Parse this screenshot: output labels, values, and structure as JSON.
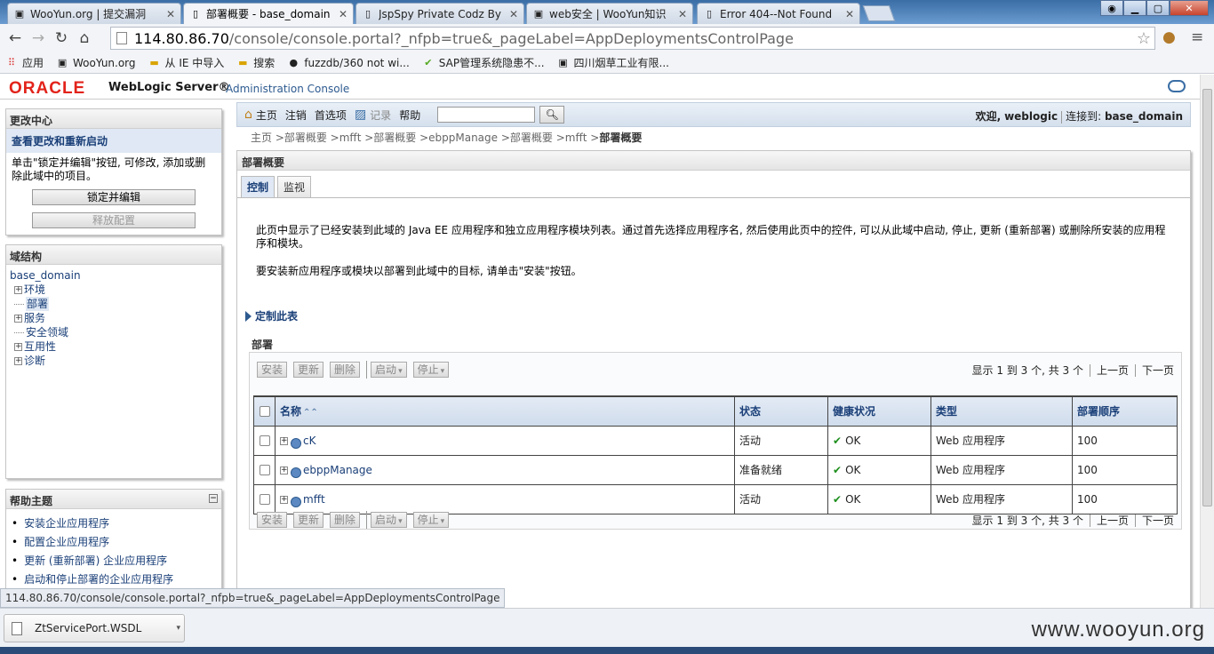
{
  "browser": {
    "tabs": [
      {
        "title": "WooYun.org | 提交漏洞",
        "active": false
      },
      {
        "title": "部署概要 - base_domain",
        "active": true
      },
      {
        "title": "JspSpy Private Codz By",
        "active": false
      },
      {
        "title": "web安全 | WooYun知识",
        "active": false
      },
      {
        "title": "Error 404--Not Found",
        "active": false
      }
    ],
    "url_host": "114.80.86.70",
    "url_path": "/console/console.portal?_nfpb=true&_pageLabel=AppDeploymentsControlPage",
    "bookmarks": [
      "应用",
      "WooYun.org",
      "从 IE 中导入",
      "搜索",
      "fuzzdb/360 not wi...",
      "SAP管理系统隐患不...",
      "四川烟草工业有限..."
    ],
    "status_url": "114.80.86.70/console/console.portal?_nfpb=true&_pageLabel=AppDeploymentsControlPage",
    "download_file": "ZtServicePort.WSDL",
    "watermark": "www.wooyun.org"
  },
  "header": {
    "oracle": "ORACLE",
    "product": "WebLogic Server®",
    "subtitle": "Administration Console"
  },
  "change_center": {
    "title": "更改中心",
    "subtitle": "查看更改和重新启动",
    "text": "单击\"锁定并编辑\"按钮, 可修改, 添加或删除此域中的项目。",
    "lock_btn": "锁定并编辑",
    "release_btn": "释放配置"
  },
  "domain_structure": {
    "title": "域结构",
    "root": "base_domain",
    "nodes": [
      {
        "label": "环境",
        "expandable": true
      },
      {
        "label": "部署",
        "expandable": false,
        "selected": true
      },
      {
        "label": "服务",
        "expandable": true
      },
      {
        "label": "安全领域",
        "expandable": false
      },
      {
        "label": "互用性",
        "expandable": true
      },
      {
        "label": "诊断",
        "expandable": true
      }
    ]
  },
  "help_topics": {
    "title": "帮助主题",
    "items": [
      "安装企业应用程序",
      "配置企业应用程序",
      "更新 (重新部署) 企业应用程序",
      "启动和停止部署的企业应用程序"
    ]
  },
  "menubar": {
    "home": "主页",
    "logout": "注销",
    "prefs": "首选项",
    "record": "记录",
    "help": "帮助",
    "welcome_label": "欢迎,",
    "user": "weblogic",
    "connected_label": "连接到:",
    "domain": "base_domain"
  },
  "breadcrumb": "主页 >部署概要 >mfft >部署概要 >ebppManage >部署概要 >mfft >",
  "breadcrumb_current": "部署概要",
  "main": {
    "title": "部署概要",
    "tabs": [
      "控制",
      "监视"
    ],
    "desc1": "此页中显示了已经安装到此域的 Java EE 应用程序和独立应用程序模块列表。通过首先选择应用程序名, 然后使用此页中的控件, 可以从此域中启动, 停止, 更新 (重新部署) 或删除所安装的应用程序和模块。",
    "desc2": "要安装新应用程序或模块以部署到此域中的目标, 请单击\"安装\"按钮。",
    "customize": "定制此表",
    "table_title": "部署",
    "buttons": {
      "install": "安装",
      "update": "更新",
      "delete": "删除",
      "start": "启动",
      "stop": "停止"
    },
    "pager": {
      "showing": "显示 1 到 3 个, 共 3 个",
      "prev": "上一页",
      "next": "下一页"
    },
    "columns": [
      "名称",
      "状态",
      "健康状况",
      "类型",
      "部署顺序"
    ],
    "rows": [
      {
        "name": "cK",
        "state": "活动",
        "health": "OK",
        "type": "Web 应用程序",
        "order": "100"
      },
      {
        "name": "ebppManage",
        "state": "准备就绪",
        "health": "OK",
        "type": "Web 应用程序",
        "order": "100"
      },
      {
        "name": "mfft",
        "state": "活动",
        "health": "OK",
        "type": "Web 应用程序",
        "order": "100"
      }
    ]
  }
}
